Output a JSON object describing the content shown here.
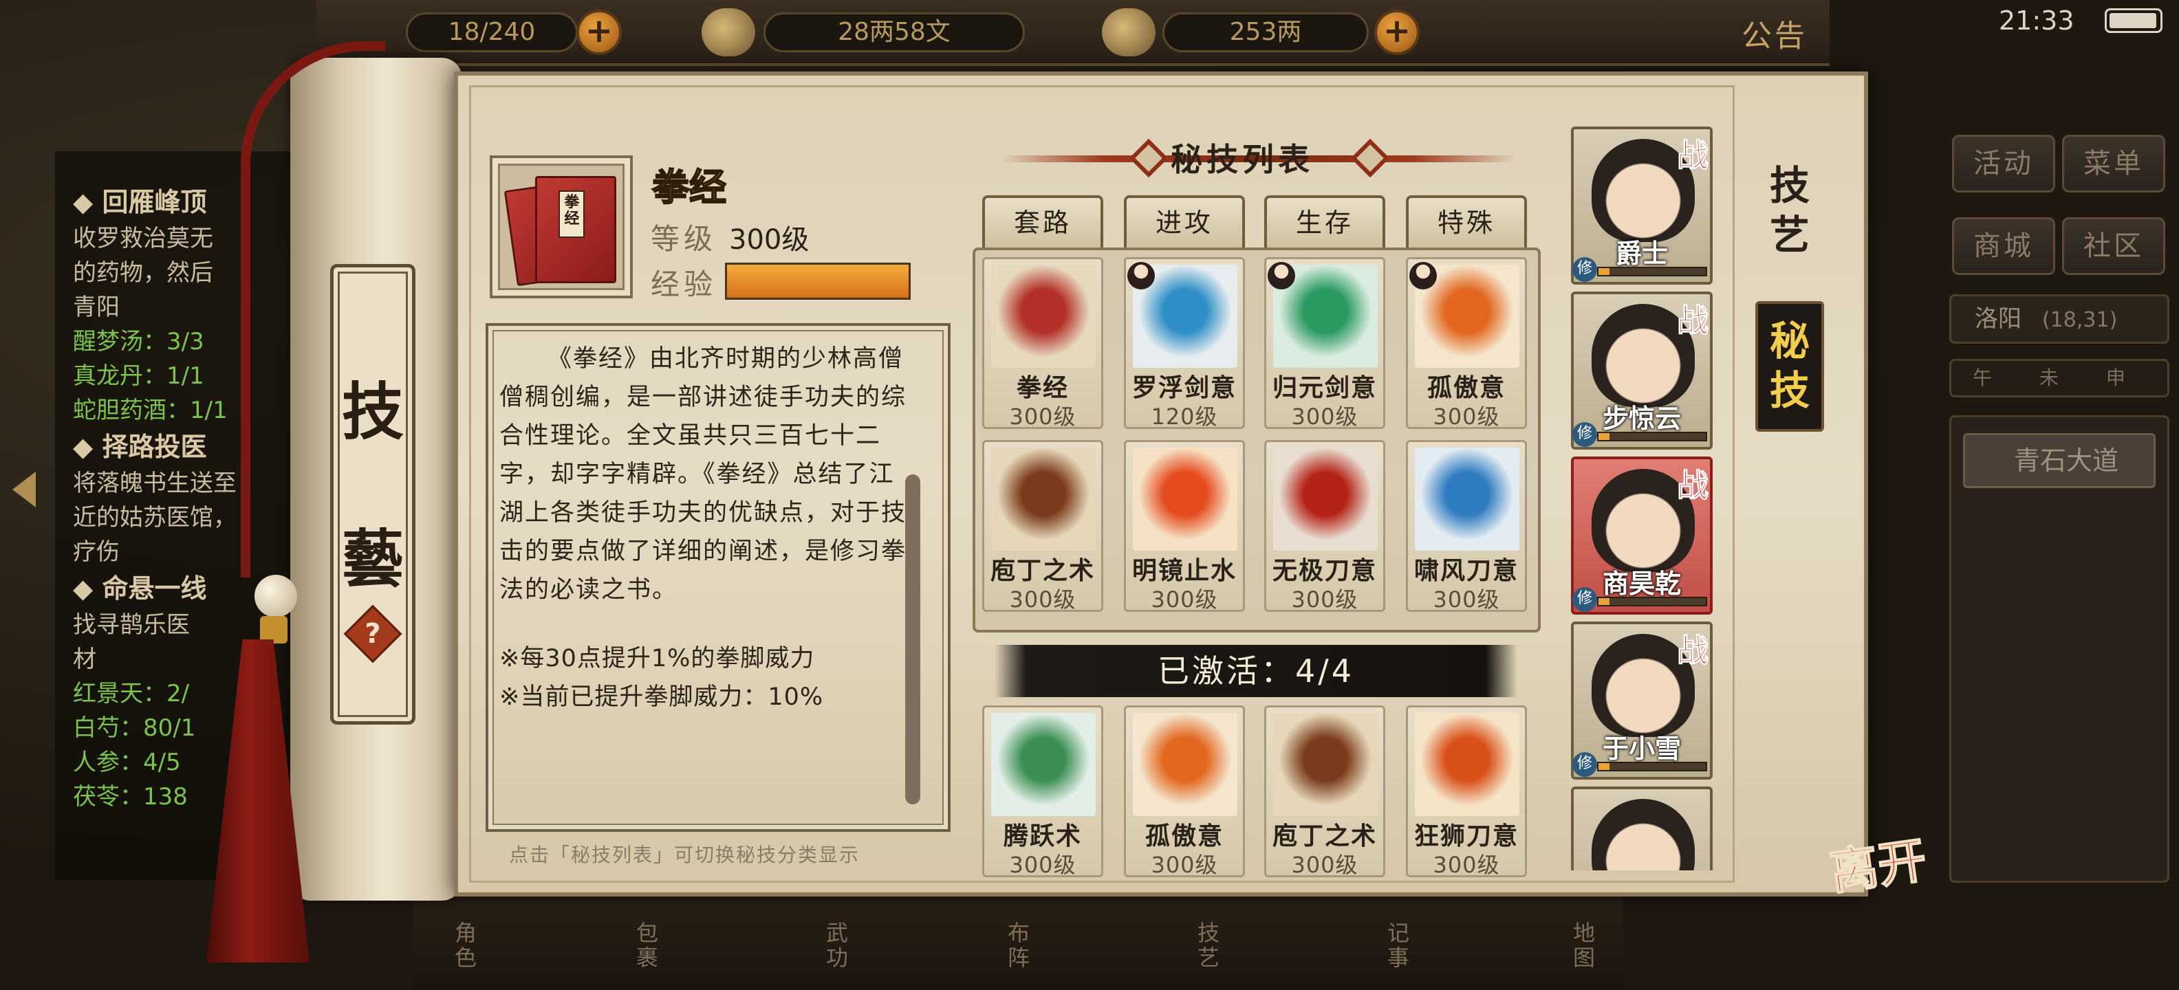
{
  "top_bar": {
    "stamina": "18/240",
    "money": "28两58文",
    "gold": "253两",
    "announcement": "公告",
    "clock": "21:33"
  },
  "quests": [
    {
      "title": "◆ 回雁峰顶",
      "lines": [
        "收罗救治莫无",
        "的药物，然后",
        "青阳"
      ],
      "items": [
        "醒梦汤：3/3",
        "真龙丹：1/1",
        "蛇胆药酒：1/1"
      ]
    },
    {
      "title": "◆ 择路投医",
      "lines": [
        "将落魄书生送至",
        "近的姑苏医馆，",
        "疗伤"
      ],
      "items": []
    },
    {
      "title": "◆ 命悬一线",
      "lines": [
        "找寻鹊乐医",
        "材"
      ],
      "items": [
        "红景天：2/",
        "白芍：80/1",
        "人参：4/5",
        "茯苓：138"
      ]
    }
  ],
  "side_menu": {
    "activity": "活动",
    "menu": "菜单",
    "shop": "商城",
    "community": "社区",
    "location": "洛阳",
    "coords": "(18,31)",
    "dial": "午 未 申",
    "place": "青石大道"
  },
  "bottom_nav": [
    "角色",
    "包裹",
    "武功",
    "布阵",
    "技艺",
    "记事",
    "地图"
  ],
  "scroll": {
    "title_top": "技",
    "title_bottom": "藝",
    "help": "?"
  },
  "skill": {
    "name": "拳经",
    "icon_label": "拳经",
    "level_label": "等级",
    "level_value": "300级",
    "exp_label": "经验",
    "exp_progress": 1.0,
    "description": "《拳经》由北齐时期的少林高僧僧稠创编，是一部讲述徒手功夫的综合性理论。全文虽共只三百七十二字，却字字精辟。《拳经》总结了江湖上各类徒手功夫的优缺点，对于技击的要点做了详细的阐述，是修习拳法的必读之书。",
    "note1": "※每30点提升1%的拳脚威力",
    "note2": "※当前已提升拳脚威力：10%",
    "tip": "点击「秘技列表」可切换秘技分类显示"
  },
  "list": {
    "title": "秘技列表",
    "tabs": [
      "套路",
      "进攻",
      "生存",
      "特殊"
    ],
    "items": [
      {
        "name": "拳经",
        "level": "300级",
        "art": "book",
        "badge": false
      },
      {
        "name": "罗浮剑意",
        "level": "120级",
        "art": "sword-blue",
        "badge": true
      },
      {
        "name": "归元剑意",
        "level": "300级",
        "art": "sword-green",
        "badge": true
      },
      {
        "name": "孤傲意",
        "level": "300级",
        "art": "monk-fire",
        "badge": true
      },
      {
        "name": "庖丁之术",
        "level": "300级",
        "art": "cleaver",
        "badge": false
      },
      {
        "name": "明镜止水",
        "level": "300级",
        "art": "monk-flame",
        "badge": false
      },
      {
        "name": "无极刀意",
        "level": "300级",
        "art": "blade-red",
        "badge": false
      },
      {
        "name": "啸风刀意",
        "level": "300级",
        "art": "blade-blue",
        "badge": false
      }
    ],
    "active_label": "已激活：4/4",
    "active": [
      {
        "name": "腾跃术",
        "level": "300级",
        "art": "leap"
      },
      {
        "name": "孤傲意",
        "level": "300级",
        "art": "monk-fire"
      },
      {
        "name": "庖丁之术",
        "level": "300级",
        "art": "cleaver"
      },
      {
        "name": "狂狮刀意",
        "level": "300级",
        "art": "lion-fire"
      }
    ]
  },
  "characters": [
    {
      "name": "爵士",
      "battle": "战",
      "xiu": "修",
      "progress": 0.1,
      "selected": false
    },
    {
      "name": "步惊云",
      "battle": "战",
      "xiu": "修",
      "progress": 0.1,
      "selected": false
    },
    {
      "name": "商昊乾",
      "battle": "战",
      "xiu": "修",
      "progress": 0.1,
      "selected": true
    },
    {
      "name": "于小雪",
      "battle": "战",
      "xiu": "修",
      "progress": 0.1,
      "selected": false
    },
    {
      "name": "",
      "battle": "",
      "xiu": "",
      "progress": 0,
      "selected": false
    }
  ],
  "vertical_tabs": {
    "skills": "技艺",
    "secret": "秘技"
  },
  "leave": "离开",
  "colors": {
    "gold_text": "#f0cf2e",
    "exp_bar": "#e58b25",
    "battle_red": "#c3211a",
    "selected_card": "#c24f45"
  }
}
